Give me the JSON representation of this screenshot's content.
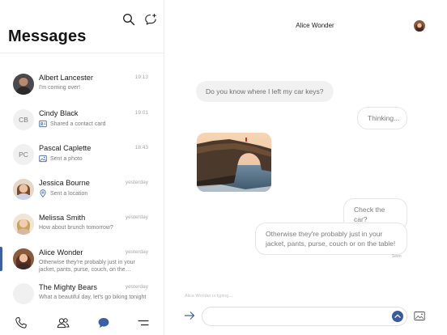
{
  "sidebar": {
    "title": "Messages",
    "header_icons": [
      "search-icon",
      "new-message-icon"
    ],
    "conversations": [
      {
        "name": "Albert Lancester",
        "time": "19:13",
        "preview": "I'm coming over!",
        "avatar": "photo",
        "preview_icon": ""
      },
      {
        "name": "Cindy Black",
        "time": "19:01",
        "preview": "Shared a contact card",
        "avatar": "CB",
        "preview_icon": "contact-card-icon"
      },
      {
        "name": "Pascal Caplette",
        "time": "18:43",
        "preview": "Sent a photo",
        "avatar": "PC",
        "preview_icon": "photo-icon"
      },
      {
        "name": "Jessica Bourne",
        "time": "yesterday",
        "preview": "Sent a location",
        "avatar": "photo",
        "preview_icon": "location-pin-icon"
      },
      {
        "name": "Melissa Smith",
        "time": "yesterday",
        "preview": "How about brunch tomorrow?",
        "avatar": "photo",
        "preview_icon": ""
      },
      {
        "name": "Alice Wonder",
        "time": "yesterday",
        "preview": "Otherwise they're probably just in your jacket, pants, purse, couch, on the…",
        "avatar": "photo",
        "preview_icon": "",
        "active": true
      },
      {
        "name": "The Mighty Bears",
        "time": "yesterday",
        "preview": "What a beautiful day, let's go biking tonight",
        "avatar": "",
        "preview_icon": ""
      }
    ],
    "footer_icons": [
      "phone-icon",
      "contacts-icon",
      "chat-bubble-icon",
      "menu-icon"
    ],
    "accent": "#3b5ea8"
  },
  "chat": {
    "contact_name": "Alice Wonder",
    "messages": [
      {
        "direction": "incoming",
        "text": "Do you know where I left my car keys?"
      },
      {
        "direction": "outgoing",
        "text": "Thinking..."
      },
      {
        "direction": "incoming",
        "type": "photo",
        "description": "rock-arch-photo"
      },
      {
        "direction": "outgoing",
        "text": "Check the car?"
      },
      {
        "direction": "outgoing",
        "text": "Otherwise they're probably just in your jacket, pants, purse, couch or on the table!"
      }
    ],
    "seen_label": "Seen",
    "typing_indicator": "Alice Wonder  is typing...",
    "composer": {
      "placeholder": "",
      "value": ""
    }
  }
}
